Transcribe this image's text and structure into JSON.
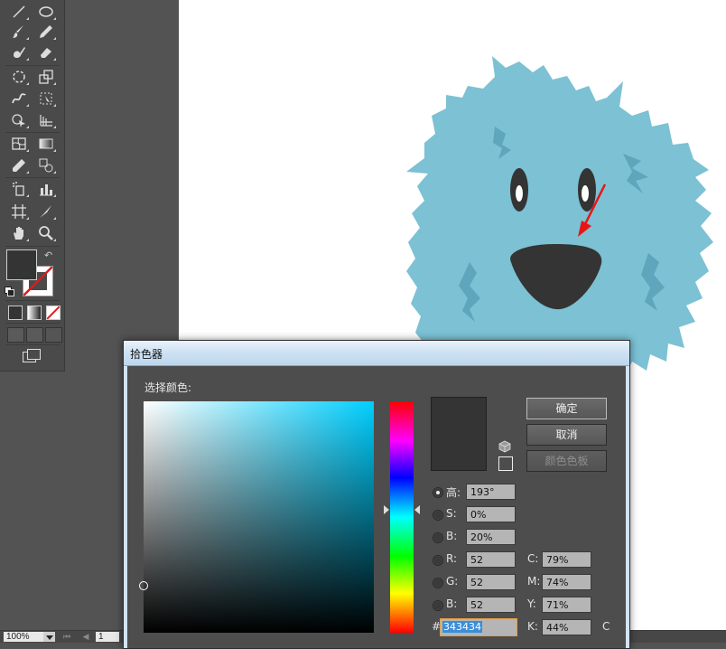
{
  "toolbox": {
    "tools": [
      {
        "name": "line-segment-tool-icon"
      },
      {
        "name": "ellipse-tool-icon"
      },
      {
        "name": "paintbrush-tool-icon"
      },
      {
        "name": "pencil-tool-icon"
      },
      {
        "name": "blob-brush-tool-icon"
      },
      {
        "name": "eraser-tool-icon"
      },
      {
        "name": "rotate-tool-icon"
      },
      {
        "name": "scale-tool-icon"
      },
      {
        "name": "warp-tool-icon"
      },
      {
        "name": "free-transform-tool-icon"
      },
      {
        "name": "shape-builder-tool-icon"
      },
      {
        "name": "perspective-grid-tool-icon"
      },
      {
        "name": "mesh-tool-icon"
      },
      {
        "name": "gradient-tool-icon"
      },
      {
        "name": "eyedropper-tool-icon"
      },
      {
        "name": "blend-tool-icon"
      },
      {
        "name": "symbol-sprayer-tool-icon"
      },
      {
        "name": "column-graph-tool-icon"
      },
      {
        "name": "artboard-tool-icon"
      },
      {
        "name": "slice-tool-icon"
      },
      {
        "name": "hand-tool-icon"
      },
      {
        "name": "zoom-tool-icon"
      }
    ],
    "fill_color": "#343434",
    "stroke": "none"
  },
  "statusbar": {
    "zoom": "100%",
    "page": "1"
  },
  "color_picker": {
    "title": "拾色器",
    "select_color_label": "选择颜色:",
    "hue_base_color": "#00cfff",
    "new_color": "#343434",
    "buttons": {
      "ok": "确定",
      "cancel": "取消",
      "color_swatches": "颜色色板"
    },
    "hsb": {
      "h_label": "高:",
      "h_value": "193°",
      "s_label": "S:",
      "s_value": "0%",
      "b_label": "B:",
      "b_value": "20%"
    },
    "rgb": {
      "r_label": "R:",
      "r_value": "52",
      "g_label": "G:",
      "g_value": "52",
      "b_label": "B:",
      "b_value": "52"
    },
    "cmyk": {
      "c_label": "C:",
      "c_value": "79%",
      "m_label": "M:",
      "m_value": "74%",
      "y_label": "Y:",
      "y_value": "71%",
      "k_label": "K:",
      "k_value": "44%"
    },
    "hex_label": "#",
    "hex_value": "343434",
    "trailing_label": "C",
    "selected_mode": "hue"
  },
  "artwork": {
    "monster_color": "#7cc1d4",
    "nose_color": "#343434",
    "arrow_color": "#e81515"
  }
}
